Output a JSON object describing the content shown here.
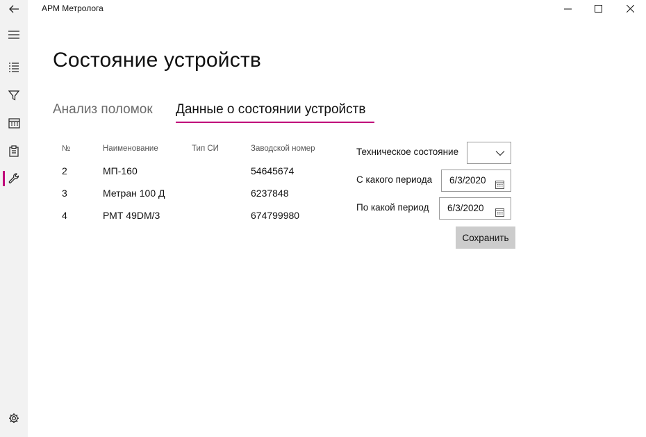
{
  "window": {
    "title": "АРМ Метролога",
    "controls": [
      "minimize-icon",
      "maximize-icon",
      "close-icon"
    ]
  },
  "nav": {
    "items": [
      {
        "icon": "back-arrow-icon"
      },
      {
        "icon": "hamburger-menu-icon"
      },
      {
        "icon": "list-icon"
      },
      {
        "icon": "funnel-icon"
      },
      {
        "icon": "calendar-icon"
      },
      {
        "icon": "clipboard-icon"
      },
      {
        "icon": "wrench-icon",
        "active": true
      },
      {
        "icon": "gear-icon"
      }
    ]
  },
  "page": {
    "title": "Состояние устройств",
    "tabs": [
      {
        "label": "Анализ поломок",
        "selected": false
      },
      {
        "label": "Данные о состоянии устройств",
        "selected": true
      }
    ]
  },
  "table": {
    "columns": [
      "№",
      "Наименование",
      "Тип СИ",
      "Заводской номер"
    ],
    "rows": [
      {
        "no": "2",
        "name": "МП-160",
        "type": "",
        "serial": "54645674"
      },
      {
        "no": "3",
        "name": "Метран 100 Д",
        "type": "",
        "serial": "6237848"
      },
      {
        "no": "4",
        "name": "РМТ 49DM/3",
        "type": "",
        "serial": "674799980"
      }
    ]
  },
  "form": {
    "state_label": "Техническое состояние",
    "state_value": "",
    "from_label": "С какого периода",
    "from_value": "6/3/2020",
    "to_label": "По какой период",
    "to_value": "6/3/2020",
    "save_label": "Сохранить"
  },
  "colors": {
    "accent": "#c0007a",
    "rail_bg": "#f2f2f2",
    "button_bg": "#cccccc"
  }
}
